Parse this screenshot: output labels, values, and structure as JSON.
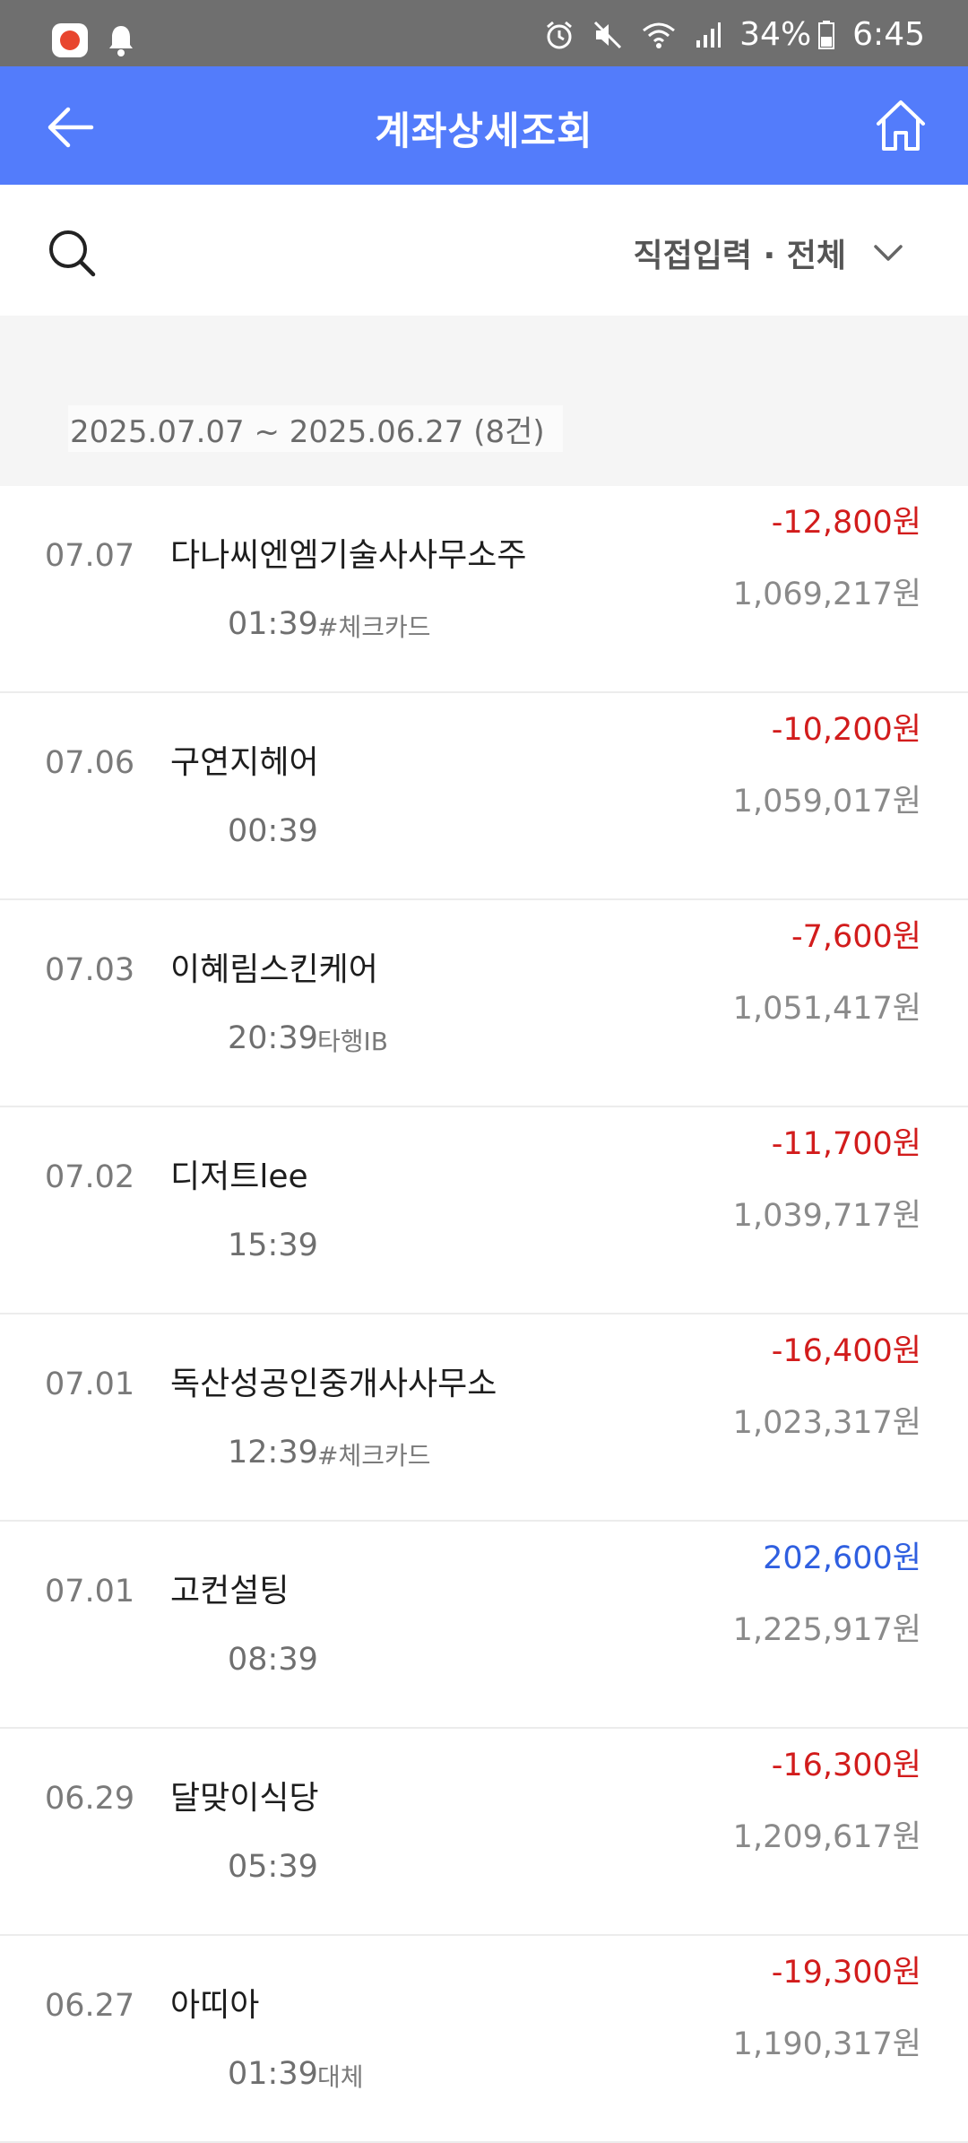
{
  "status_bar": {
    "battery_text": "34%",
    "time": "6:45",
    "icons": [
      "app-badge-icon",
      "bell-icon",
      "alarm-icon",
      "mute-icon",
      "wifi-icon",
      "signal-icon",
      "battery-icon"
    ]
  },
  "header": {
    "title": "계좌상세조회",
    "background": "#537cfb"
  },
  "search": {
    "filter_label": "직접입력 · 전체"
  },
  "period": {
    "text": "2025.07.07 ~ 2025.06.27 (8건)"
  },
  "colors": {
    "withdrawal": "#d21c1c",
    "deposit": "#2f5fe0"
  },
  "transactions": [
    {
      "date": "07.07",
      "merchant": "다나씨엔엠기술사사무소주",
      "time": "01:39",
      "memo": "#체크카드",
      "amount": "-12,800원",
      "balance": "1,069,217원",
      "type": "withdrawal"
    },
    {
      "date": "07.06",
      "merchant": "구연지헤어",
      "time": "00:39",
      "memo": "",
      "amount": "-10,200원",
      "balance": "1,059,017원",
      "type": "withdrawal"
    },
    {
      "date": "07.03",
      "merchant": "이혜림스킨케어",
      "time": "20:39",
      "memo": "타행IB",
      "amount": "-7,600원",
      "balance": "1,051,417원",
      "type": "withdrawal"
    },
    {
      "date": "07.02",
      "merchant": "디저트lee",
      "time": "15:39",
      "memo": "",
      "amount": "-11,700원",
      "balance": "1,039,717원",
      "type": "withdrawal"
    },
    {
      "date": "07.01",
      "merchant": "독산성공인중개사사무소",
      "time": "12:39",
      "memo": "#체크카드",
      "amount": "-16,400원",
      "balance": "1,023,317원",
      "type": "withdrawal"
    },
    {
      "date": "07.01",
      "merchant": "고컨설팅",
      "time": "08:39",
      "memo": "",
      "amount": "202,600원",
      "balance": "1,225,917원",
      "type": "deposit"
    },
    {
      "date": "06.29",
      "merchant": "달맞이식당",
      "time": "05:39",
      "memo": "",
      "amount": "-16,300원",
      "balance": "1,209,617원",
      "type": "withdrawal"
    },
    {
      "date": "06.27",
      "merchant": "아띠아",
      "time": "01:39",
      "memo": "대체",
      "amount": "-19,300원",
      "balance": "1,190,317원",
      "type": "withdrawal"
    }
  ]
}
